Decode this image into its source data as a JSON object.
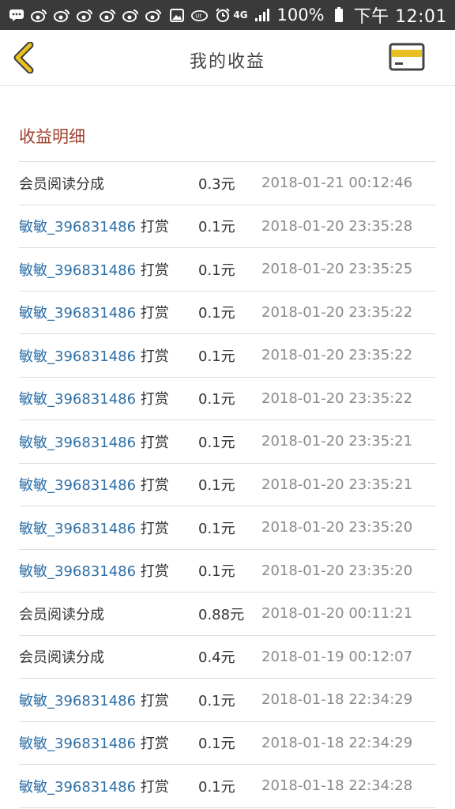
{
  "status_bar": {
    "battery": "100%",
    "time": "下午 12:01",
    "network": "4G",
    "icons": [
      "chat-bubble-icon",
      "weibo-icon",
      "weibo-icon",
      "weibo-icon",
      "weibo-icon",
      "weibo-icon",
      "weibo-icon",
      "image-icon",
      "uc-icon",
      "alarm-icon",
      "signal-icon",
      "battery-icon"
    ]
  },
  "header": {
    "title": "我的收益",
    "back_icon": "chevron-left-icon",
    "card_icon": "credit-card-icon",
    "accent_color": "#e8c021"
  },
  "section": {
    "title": "收益明细"
  },
  "records": [
    {
      "name": "会员阅读分成",
      "action": "",
      "is_user": false,
      "amount": "0.3元",
      "time": "2018-01-21 00:12:46"
    },
    {
      "name": "敏敏_396831486",
      "action": " 打赏",
      "is_user": true,
      "amount": "0.1元",
      "time": "2018-01-20 23:35:28"
    },
    {
      "name": "敏敏_396831486",
      "action": " 打赏",
      "is_user": true,
      "amount": "0.1元",
      "time": "2018-01-20 23:35:25"
    },
    {
      "name": "敏敏_396831486",
      "action": " 打赏",
      "is_user": true,
      "amount": "0.1元",
      "time": "2018-01-20 23:35:22"
    },
    {
      "name": "敏敏_396831486",
      "action": " 打赏",
      "is_user": true,
      "amount": "0.1元",
      "time": "2018-01-20 23:35:22"
    },
    {
      "name": "敏敏_396831486",
      "action": " 打赏",
      "is_user": true,
      "amount": "0.1元",
      "time": "2018-01-20 23:35:22"
    },
    {
      "name": "敏敏_396831486",
      "action": " 打赏",
      "is_user": true,
      "amount": "0.1元",
      "time": "2018-01-20 23:35:21"
    },
    {
      "name": "敏敏_396831486",
      "action": " 打赏",
      "is_user": true,
      "amount": "0.1元",
      "time": "2018-01-20 23:35:21"
    },
    {
      "name": "敏敏_396831486",
      "action": " 打赏",
      "is_user": true,
      "amount": "0.1元",
      "time": "2018-01-20 23:35:20"
    },
    {
      "name": "敏敏_396831486",
      "action": " 打赏",
      "is_user": true,
      "amount": "0.1元",
      "time": "2018-01-20 23:35:20"
    },
    {
      "name": "会员阅读分成",
      "action": "",
      "is_user": false,
      "amount": "0.88元",
      "time": "2018-01-20 00:11:21"
    },
    {
      "name": "会员阅读分成",
      "action": "",
      "is_user": false,
      "amount": "0.4元",
      "time": "2018-01-19 00:12:07"
    },
    {
      "name": "敏敏_396831486",
      "action": " 打赏",
      "is_user": true,
      "amount": "0.1元",
      "time": "2018-01-18 22:34:29"
    },
    {
      "name": "敏敏_396831486",
      "action": " 打赏",
      "is_user": true,
      "amount": "0.1元",
      "time": "2018-01-18 22:34:29"
    },
    {
      "name": "敏敏_396831486",
      "action": " 打赏",
      "is_user": true,
      "amount": "0.1元",
      "time": "2018-01-18 22:34:28"
    }
  ]
}
